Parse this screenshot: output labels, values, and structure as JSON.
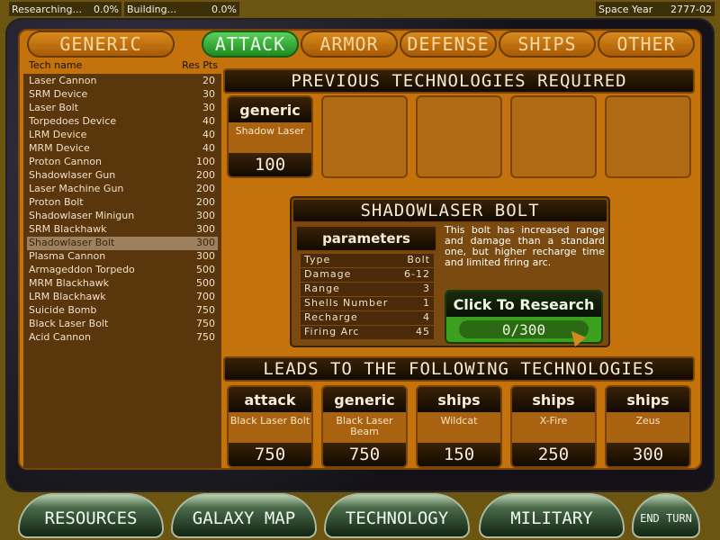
{
  "status": {
    "researching_label": "Researching...",
    "researching_value": "0.0%",
    "building_label": "Building...",
    "building_value": "0.0%",
    "space_year_label": "Space Year",
    "space_year_value": "2777-02"
  },
  "tabs": [
    {
      "label": "GENERIC"
    },
    {
      "label": "ATTACK",
      "active": true
    },
    {
      "label": "ARMOR"
    },
    {
      "label": "DEFENSE"
    },
    {
      "label": "SHIPS"
    },
    {
      "label": "OTHER"
    }
  ],
  "tech_list": {
    "col_name": "Tech name",
    "col_pts": "Res Pts",
    "selected": "Shadowlaser Bolt",
    "items": [
      {
        "name": "Laser Cannon",
        "pts": "20"
      },
      {
        "name": "SRM Device",
        "pts": "30"
      },
      {
        "name": "Laser Bolt",
        "pts": "30"
      },
      {
        "name": "Torpedoes Device",
        "pts": "40"
      },
      {
        "name": "LRM Device",
        "pts": "40"
      },
      {
        "name": "MRM Device",
        "pts": "40"
      },
      {
        "name": "Proton Cannon",
        "pts": "100"
      },
      {
        "name": "Shadowlaser Gun",
        "pts": "200"
      },
      {
        "name": "Laser Machine Gun",
        "pts": "200"
      },
      {
        "name": "Proton Bolt",
        "pts": "200"
      },
      {
        "name": "Shadowlaser Minigun",
        "pts": "300"
      },
      {
        "name": "SRM Blackhawk",
        "pts": "300"
      },
      {
        "name": "Shadowlaser Bolt",
        "pts": "300"
      },
      {
        "name": "Plasma Cannon",
        "pts": "300"
      },
      {
        "name": "Armageddon Torpedo",
        "pts": "500"
      },
      {
        "name": "MRM Blackhawk",
        "pts": "500"
      },
      {
        "name": "LRM Blackhawk",
        "pts": "700"
      },
      {
        "name": "Suicide Bomb",
        "pts": "750"
      },
      {
        "name": "Black Laser Bolt",
        "pts": "750"
      },
      {
        "name": "Acid Cannon",
        "pts": "750"
      }
    ]
  },
  "previous": {
    "title": "PREVIOUS TECHNOLOGIES REQUIRED",
    "items": [
      {
        "category": "generic",
        "name": "Shadow Laser",
        "pts": "100"
      }
    ]
  },
  "detail": {
    "title": "SHADOWLASER BOLT",
    "params_title": "parameters",
    "params": [
      {
        "k": "Type",
        "v": "Bolt"
      },
      {
        "k": "Damage",
        "v": "6-12"
      },
      {
        "k": "Range",
        "v": "3"
      },
      {
        "k": "Shells Number",
        "v": "1"
      },
      {
        "k": "Recharge",
        "v": "4"
      },
      {
        "k": "Firing Arc",
        "v": "45"
      }
    ],
    "description": "This bolt has increased range and damage than a standard one, but higher recharge time and limited firing arc.",
    "research_button": "Click To Research",
    "progress": "0/300"
  },
  "leads": {
    "title": "LEADS TO THE FOLLOWING TECHNOLOGIES",
    "items": [
      {
        "category": "attack",
        "name": "Black Laser Bolt",
        "pts": "750"
      },
      {
        "category": "generic",
        "name": "Black Laser Beam",
        "pts": "750"
      },
      {
        "category": "ships",
        "name": "Wildcat",
        "pts": "150"
      },
      {
        "category": "ships",
        "name": "X-Fire",
        "pts": "250"
      },
      {
        "category": "ships",
        "name": "Zeus",
        "pts": "300"
      }
    ]
  },
  "nav": {
    "resources": "RESOURCES",
    "galaxy_map": "GALAXY MAP",
    "technology": "TECHNOLOGY",
    "military": "MILITARY",
    "end_turn": "END TURN"
  }
}
